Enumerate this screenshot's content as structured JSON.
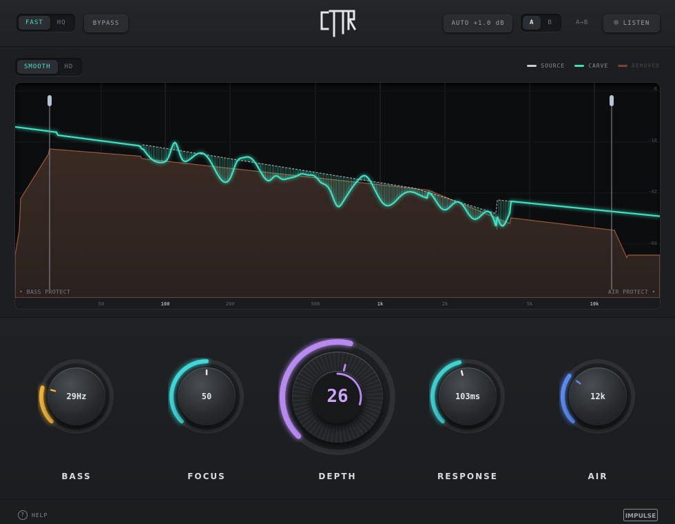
{
  "top": {
    "quality_modes": [
      "FAST",
      "HQ"
    ],
    "bypass_label": "BYPASS",
    "auto_gain": "AUTO +1.0 dB",
    "ab_options": [
      "A",
      "B"
    ],
    "ab_copy": "A→B",
    "listen_label": "LISTEN"
  },
  "display": {
    "view_modes": [
      "SMOOTH",
      "HD"
    ],
    "legend": [
      {
        "label": "SOURCE",
        "color": "#c9cdd2"
      },
      {
        "label": "CARVE",
        "color": "#3fe0c0"
      },
      {
        "label": "REMOVED",
        "color": "#8a4e36"
      }
    ],
    "freq_ticks": [
      "50",
      "100",
      "200",
      "500",
      "1k",
      "2k",
      "5k",
      "10k"
    ],
    "db_ticks": [
      "6",
      "-18",
      "-42",
      "-66"
    ],
    "bass_protect": "• BASS PROTECT",
    "air_protect": "AIR PROTECT •"
  },
  "knobs": [
    {
      "label": "BASS",
      "value": "29Hz",
      "level": 0.22,
      "color": "#f0b43c"
    },
    {
      "label": "FOCUS",
      "value": "50",
      "level": 0.5,
      "color": "#3fd8d8"
    },
    {
      "label": "DEPTH",
      "value": "26",
      "level": 0.55,
      "color": "#b78af0"
    },
    {
      "label": "RESPONSE",
      "value": "103ms",
      "level": 0.45,
      "color": "#3fd0d0"
    },
    {
      "label": "AIR",
      "value": "12k",
      "level": 0.3,
      "color": "#5a8cf0"
    }
  ],
  "footer": {
    "help_label": "HELP",
    "brand": "IMPULSE"
  }
}
